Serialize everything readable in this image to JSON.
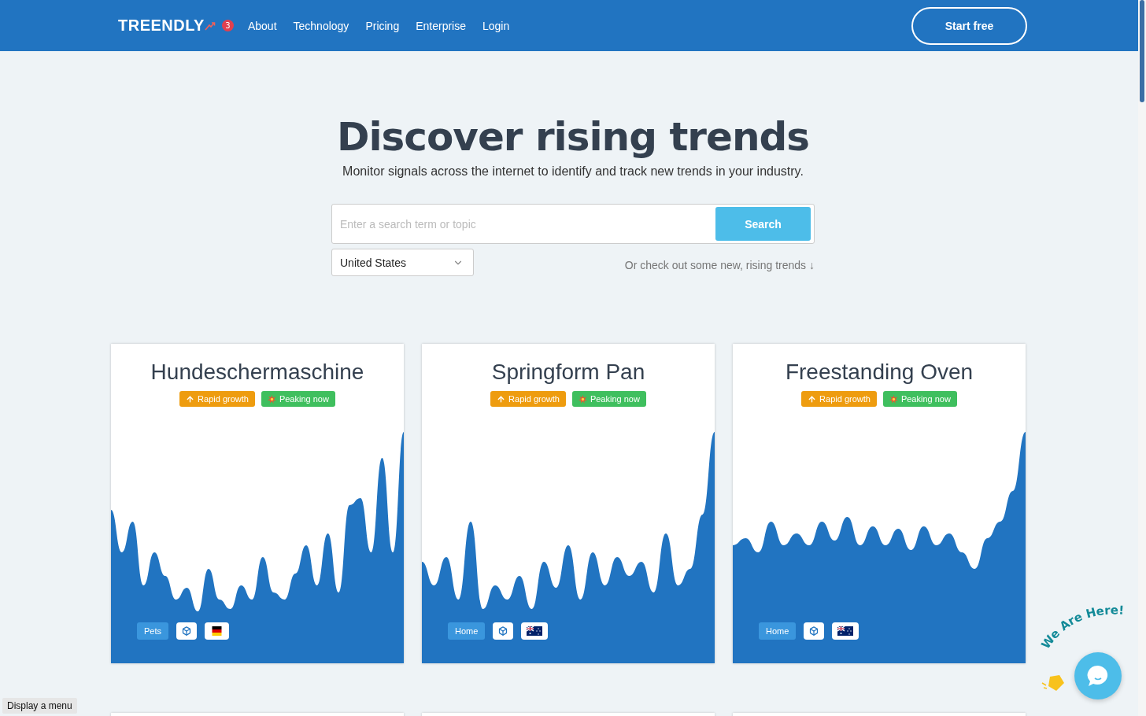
{
  "nav": {
    "logo": "TREENDLY",
    "badge": "3",
    "links": [
      "About",
      "Technology",
      "Pricing",
      "Enterprise",
      "Login"
    ],
    "cta": "Start free"
  },
  "hero": {
    "title": "Discover rising trends",
    "subtitle": "Monitor signals across the internet to identify and track new trends in your industry."
  },
  "search": {
    "placeholder": "Enter a search term or topic",
    "button": "Search",
    "country": "United States",
    "hint": "Or check out some new, rising trends ↓"
  },
  "cards": [
    {
      "title": "Hundeschermaschine",
      "tags": [
        {
          "kind": "growth",
          "label": "Rapid growth"
        },
        {
          "kind": "peak",
          "label": "Peaking now"
        }
      ],
      "category": "Pets",
      "flag": {
        "kind": "de"
      }
    },
    {
      "title": "Springform Pan",
      "tags": [
        {
          "kind": "growth",
          "label": "Rapid growth"
        },
        {
          "kind": "peak",
          "label": "Peaking now"
        }
      ],
      "category": "Home",
      "flag": {
        "kind": "au"
      }
    },
    {
      "title": "Freestanding Oven",
      "tags": [
        {
          "kind": "growth",
          "label": "Rapid growth"
        },
        {
          "kind": "peak",
          "label": "Peaking now"
        }
      ],
      "category": "Home",
      "flag": {
        "kind": "au"
      }
    }
  ],
  "chat": {
    "label": "We Are Here!"
  },
  "tooltip": "Display a menu"
}
